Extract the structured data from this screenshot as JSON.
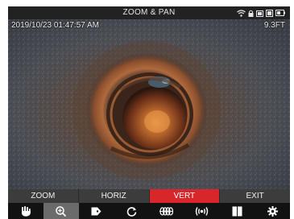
{
  "status_bar": {
    "title": "ZOOM & PAN",
    "icons": [
      "wifi-icon",
      "lock-icon",
      "battery-icon",
      "sd-card-icon",
      "battery-level-icon"
    ]
  },
  "camera": {
    "timestamp": "2019/10/23 01:47:57 AM",
    "distance": "9.3FT"
  },
  "menu": {
    "items": [
      {
        "label": "ZOOM",
        "active": false
      },
      {
        "label": "HORIZ",
        "active": false
      },
      {
        "label": "VERT",
        "active": true
      },
      {
        "label": "EXIT",
        "active": false
      }
    ],
    "active_color": "#d9262a"
  },
  "toolbar": {
    "icons": [
      "hand-icon",
      "zoom-in-icon",
      "tag-icon",
      "rotate-icon",
      "coil-icon",
      "signal-icon",
      "split-view-icon",
      "settings-icon"
    ],
    "active": "zoom-in-icon"
  }
}
